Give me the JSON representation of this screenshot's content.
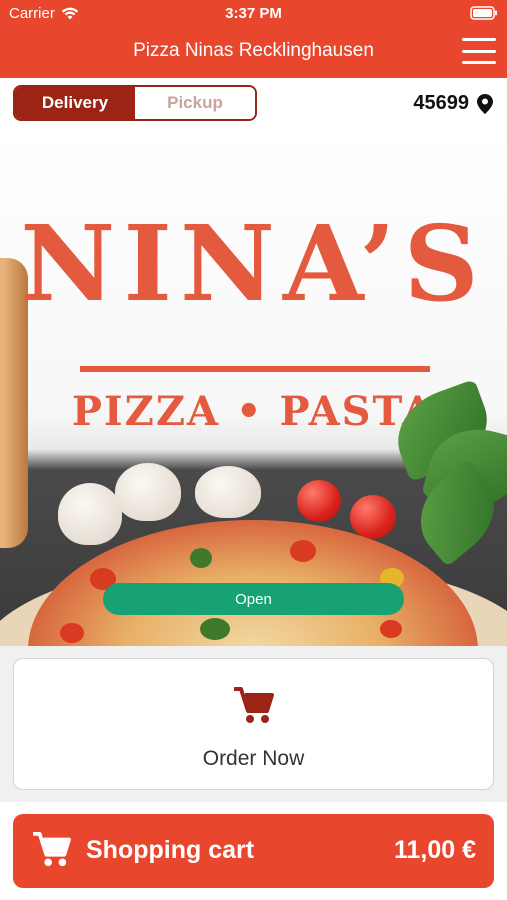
{
  "status_bar": {
    "carrier": "Carrier",
    "time": "3:37 PM"
  },
  "header": {
    "title": "Pizza Ninas Recklinghausen",
    "menu_icon": "hamburger-menu-icon"
  },
  "order_mode": {
    "options": [
      {
        "label": "Delivery",
        "selected": true
      },
      {
        "label": "Pickup",
        "selected": false
      }
    ],
    "zip_code": "45699",
    "location_icon": "map-pin-icon"
  },
  "hero": {
    "logo_name": "NINA’S",
    "logo_subtitle": "PIZZA • PASTA"
  },
  "status": {
    "label": "Open",
    "color": "#16a274"
  },
  "order_now": {
    "label": "Order Now",
    "icon": "cart-icon",
    "icon_color": "#9b2417"
  },
  "cart": {
    "label": "Shopping cart",
    "total": "11,00 €",
    "icon": "cart-icon"
  },
  "colors": {
    "brand": "#e8462d",
    "brand_dark": "#9b2417",
    "open_green": "#16a274"
  }
}
